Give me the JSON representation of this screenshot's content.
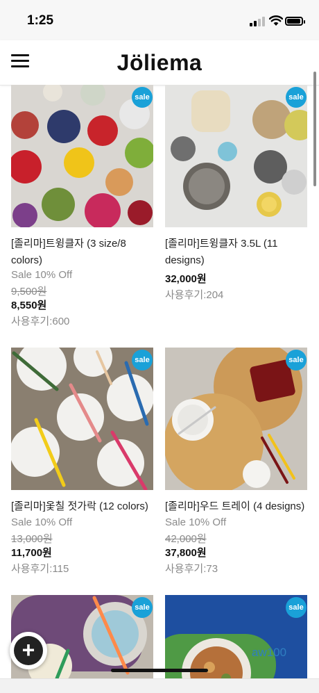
{
  "status_bar": {
    "time": "1:25"
  },
  "header": {
    "logo_text": "Jöliema"
  },
  "products": [
    {
      "name": "[졸리마]트윙클자 (3 size/8 colors)",
      "sale_label": "Sale 10% Off",
      "original_price": "9,500원",
      "price": "8,550원",
      "reviews": "사용후기:600",
      "badge": "sale"
    },
    {
      "name": "[졸리마]트윙클자 3.5L (11 designs)",
      "price": "32,000원",
      "reviews": "사용후기:204",
      "badge": "sale"
    },
    {
      "name": "[졸리마]옻칠 젓가락 (12 colors)",
      "sale_label": "Sale 10% Off",
      "original_price": "13,000원",
      "price": "11,700원",
      "reviews": "사용후기:115",
      "badge": "sale"
    },
    {
      "name": "[졸리마]우드 트레이 (4 designs)",
      "sale_label": "Sale 10% Off",
      "original_price": "42,000원",
      "price": "37,800원",
      "reviews": "사용후기:73",
      "badge": "sale"
    },
    {
      "badge": "sale"
    },
    {
      "badge": "sale"
    }
  ],
  "fab": {
    "icon": "plus-icon",
    "label": "+"
  },
  "watermark": "aw100",
  "colors": {
    "sale_badge": "#1aa1d8",
    "muted_text": "#8a8a8a",
    "price_text": "#111111"
  }
}
